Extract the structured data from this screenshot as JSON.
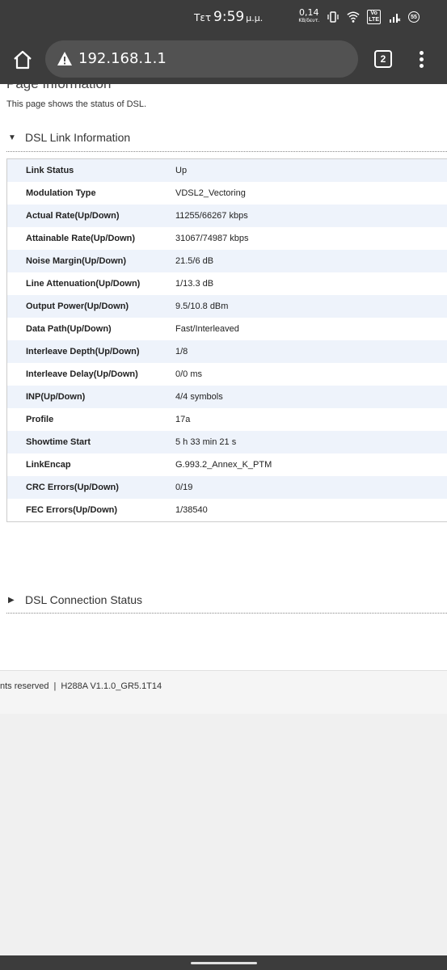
{
  "status_bar": {
    "day": "Τετ",
    "time": "9:59",
    "ampm": "μ.μ.",
    "speed_value": "0,14",
    "speed_unit": "KB/δευτ.",
    "volte_top": "Vo",
    "volte_bottom": "LTE",
    "battery": "55",
    "icons": [
      "vibrate-icon",
      "wifi-icon",
      "volte-icon",
      "signal-icon",
      "battery-icon"
    ]
  },
  "browser": {
    "url": "192.168.1.1",
    "tab_count": "2",
    "icons": [
      "home-icon",
      "warning-icon",
      "tabs-icon",
      "more-vert-icon"
    ]
  },
  "page": {
    "title": "Page Information",
    "description": "This page shows the status of DSL."
  },
  "sections": {
    "link_info": {
      "label": "DSL Link Information",
      "expanded": true
    },
    "connection_status": {
      "label": "DSL Connection Status",
      "expanded": false
    }
  },
  "dsl_link_rows": [
    {
      "key": "Link Status",
      "value": "Up"
    },
    {
      "key": "Modulation Type",
      "value": "VDSL2_Vectoring"
    },
    {
      "key": "Actual Rate(Up/Down)",
      "value": "11255/66267 kbps"
    },
    {
      "key": "Attainable Rate(Up/Down)",
      "value": "31067/74987 kbps"
    },
    {
      "key": "Noise Margin(Up/Down)",
      "value": "21.5/6 dB"
    },
    {
      "key": "Line Attenuation(Up/Down)",
      "value": "1/13.3 dB"
    },
    {
      "key": "Output Power(Up/Down)",
      "value": "9.5/10.8 dBm"
    },
    {
      "key": "Data Path(Up/Down)",
      "value": "Fast/Interleaved"
    },
    {
      "key": "Interleave Depth(Up/Down)",
      "value": "1/8"
    },
    {
      "key": "Interleave Delay(Up/Down)",
      "value": "0/0 ms"
    },
    {
      "key": "INP(Up/Down)",
      "value": "4/4 symbols"
    },
    {
      "key": "Profile",
      "value": "17a"
    },
    {
      "key": "Showtime Start",
      "value": "5 h 33 min 21 s"
    },
    {
      "key": "LinkEncap",
      "value": "G.993.2_Annex_K_PTM"
    },
    {
      "key": "CRC Errors(Up/Down)",
      "value": "0/19"
    },
    {
      "key": "FEC Errors(Up/Down)",
      "value": "1/38540"
    }
  ],
  "footer": {
    "rights": "nts reserved",
    "separator": "|",
    "version": "H288A V1.1.0_GR5.1T14"
  },
  "colors": {
    "chrome": "#3c3c3c",
    "urlbar": "#525252",
    "row_alt": "#eef3fb",
    "page_bg": "#f0f0f0"
  }
}
